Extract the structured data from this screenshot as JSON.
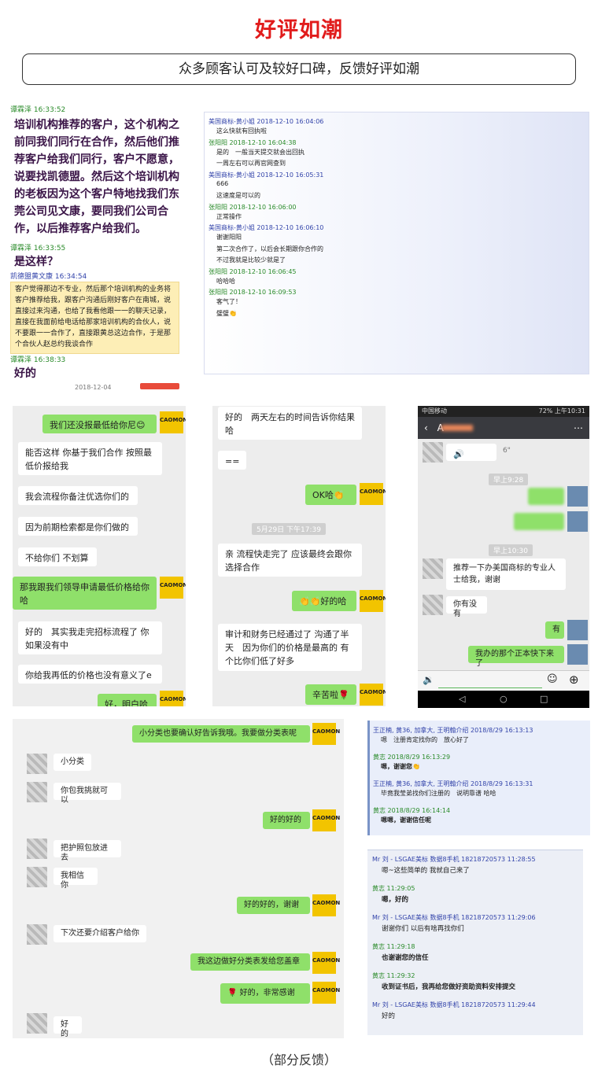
{
  "header": {
    "title": "好评如潮",
    "subtitle": "众多顾客认可及较好口碑，反馈好评如潮",
    "caption": "（部分反馈）"
  },
  "colors": {
    "title": "#e11b1b",
    "bubble_green": "#8fe06a",
    "logo_yellow": "#f2c400"
  },
  "s1": {
    "ts1": "谭霖泽 16:33:52",
    "msg1": "培训机构推荐的客户，这个机构之前同我们同行在合作，然后他们推荐客户给我们同行，客户不愿意，说要找凯德盟。然后这个培训机构的老板因为这个客户特地找我们东莞公司见文康，要同我们公司合作，以后推荐客户给我们。",
    "ts2": "谭霖泽 16:33:55",
    "msg2": "是这样？",
    "ts3": "凯德盟黄文康 16:34:54",
    "msg3": "客户觉得那边不专业，然后那个培训机构的业务将客户推荐给我，跟客户沟通后刚好客户在南城，说直接过来沟通，也给了我看他跟一一的聊天记录，直接在我面前给电话给那家培训机构的合伙人，说不要跟一一合作了，直接跟黄总这边合作，于是那个合伙人赵总约我谈合作",
    "ts4": "谭霖泽 16:38:33",
    "msg4": "好的",
    "cut": "2018-12-04"
  },
  "s2": {
    "rows": [
      {
        "h": "美国商标-黄小姐 2018-12-10 16:04:06",
        "t": "这么快就有回执啦"
      },
      {
        "h": "张阳阳 2018-12-10 16:04:38",
        "t": "是的　一般当天提交就会出回执"
      },
      {
        "h": "",
        "t": "一周左右可以再官网查到"
      },
      {
        "h": "美国商标-黄小姐 2018-12-10 16:05:31",
        "t": "666"
      },
      {
        "h": "",
        "t": "这速度是可以的"
      },
      {
        "h": "张阳阳 2018-12-10 16:06:00",
        "t": "正常操作"
      },
      {
        "h": "美国商标-黄小姐 2018-12-10 16:06:10",
        "t": "谢谢阳阳"
      },
      {
        "h": "",
        "t": "第二次合作了，以后会长期跟你合作的"
      },
      {
        "h": "",
        "t": "不过我就是比较少就是了"
      },
      {
        "h": "张阳阳 2018-12-10 16:06:45",
        "t": "哈哈哈"
      },
      {
        "h": "张阳阳 2018-12-10 16:09:53",
        "t": "客气了！"
      },
      {
        "h": "",
        "t": "璧璧👏"
      }
    ]
  },
  "s3": {
    "logo": "CAOMON",
    "b": [
      "我们还没报最低给你尼😊",
      "能否这样 你基于我们合作 按照最低价报给我",
      "我会流程你备注优选你们的",
      "因为前期检索都是你们做的",
      "不给你们 不划算",
      "那我跟我们领导申请最低价格给你哈",
      "好的　其实我走完招标流程了 你如果没有中",
      "你给我再低的价格也没有意义了e",
      "好，明白哈"
    ]
  },
  "s4": {
    "b": [
      "好的　两天左右的时间告诉你结果哈",
      "==",
      "OK哈👏",
      "亲 流程快走完了 应该最终会跟你选择合作",
      "👏👏好的哈",
      "审计和财务已经通过了 沟通了半天　因为你们的价格是最高的 有个比你们低了好多",
      "辛苦啦🌹"
    ],
    "time": "5月29日 下午17:39"
  },
  "s5": {
    "status_left": "中国移动",
    "status_right": "72% 上午10:31",
    "name": "A",
    "voice": "6\"",
    "time1": "早上9:28",
    "time2": "早上10:30",
    "b": [
      "推荐一下办美国商标的专业人士给我，谢谢",
      "你有没有",
      "有",
      "我办的那个正本快下来了"
    ]
  },
  "s6": {
    "b": [
      "小分类也要确认好告诉我哦。我要做分类表呢",
      "小分类",
      "你包我挑就可以",
      "好的好的",
      "把护照包放进去",
      "我相信你",
      "好的好的，谢谢",
      "下次还要介绍客户给你",
      "我这边做好分类表发给您盖章",
      "🌹 好的，非常感谢",
      "好的"
    ]
  },
  "s7": {
    "rows": [
      {
        "h": "王正楠, 黄36, 加拿大, 王明翰介绍 2018/8/29 16:13:13",
        "t": "嗯　注册肯定找你的　放心好了"
      },
      {
        "h": "黄志 2018/8/29 16:13:29",
        "t": "嗯，谢谢您👏"
      },
      {
        "h": "王正楠, 黄36, 加拿大, 王明翰介绍 2018/8/29 16:13:31",
        "t": "毕竟我莹弟找你们注册的　说明靠谱 哈哈"
      },
      {
        "h": "黄志 2018/8/29 16:14:14",
        "t": "嗯嗯，谢谢信任呢"
      }
    ]
  },
  "s8": {
    "rows": [
      {
        "h": "Mr 刘 - LSGAE美标 数据8手机 18218720573 11:28:55",
        "t": "嗯~这些简单的 我就自己来了"
      },
      {
        "h": "黄志 11:29:05",
        "t": "嗯，好的"
      },
      {
        "h": "Mr 刘 - LSGAE美标 数据8手机 18218720573 11:29:06",
        "t": "谢谢你们 以后有啥再找你们"
      },
      {
        "h": "黄志 11:29:18",
        "t": "也谢谢您的信任"
      },
      {
        "h": "黄志 11:29:32",
        "t": "收到证书后，我再给您做好资助资料安排提交"
      },
      {
        "h": "Mr 刘 - LSGAE美标 数据8手机 18218720573 11:29:44",
        "t": "好的"
      }
    ]
  }
}
